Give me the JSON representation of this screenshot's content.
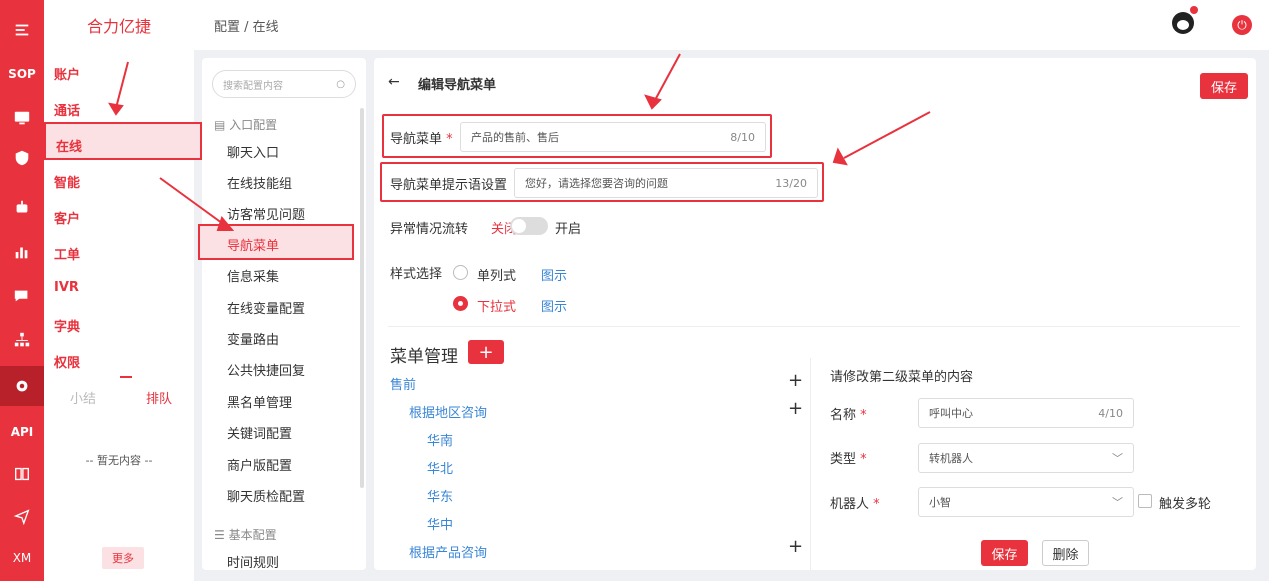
{
  "rail": {
    "items": [
      "SOP",
      "API",
      "XM"
    ]
  },
  "brand": "合力亿捷",
  "nav": {
    "items": [
      "账户",
      "通话",
      "在线",
      "智能",
      "客户",
      "工单",
      "IVR",
      "字典",
      "权限"
    ],
    "tab_summary": "小结",
    "tab_queue": "排队",
    "empty": "-- 暂无内容 --",
    "more": "更多"
  },
  "breadcrumb": "配置 / 在线",
  "sub": {
    "search_placeholder": "搜索配置内容",
    "group1": "入口配置",
    "items1": [
      "聊天入口",
      "在线技能组",
      "访客常见问题",
      "导航菜单",
      "信息采集",
      "在线变量配置",
      "变量路由",
      "公共快捷回复",
      "黑名单管理",
      "关键词配置",
      "商户版配置",
      "聊天质检配置"
    ],
    "group2": "基本配置",
    "items2": [
      "时间规则"
    ]
  },
  "main": {
    "title": "编辑导航菜单",
    "save": "保存",
    "menu_label": "导航菜单",
    "menu_value": "产品的售前、售后",
    "menu_count": "8/10",
    "tip_label": "导航菜单提示语设置",
    "tip_value": "您好，请选择您要咨询的问题",
    "tip_count": "13/20",
    "abnormal_label": "异常情况流转",
    "off": "关闭",
    "on": "开启",
    "style_label": "样式选择",
    "opt1": "单列式",
    "opt2": "下拉式",
    "illus": "图示",
    "mgmt_title": "菜单管理",
    "tree": [
      "售前",
      "根据地区咨询",
      "华南",
      "华北",
      "华东",
      "华中",
      "根据产品咨询"
    ],
    "edit_title": "请修改第二级菜单的内容",
    "name_label": "名称",
    "name_value": "呼叫中心",
    "name_count": "4/10",
    "type_label": "类型",
    "type_value": "转机器人",
    "robot_label": "机器人",
    "robot_value": "小智",
    "multi": "触发多轮",
    "save2": "保存",
    "delete": "删除"
  }
}
